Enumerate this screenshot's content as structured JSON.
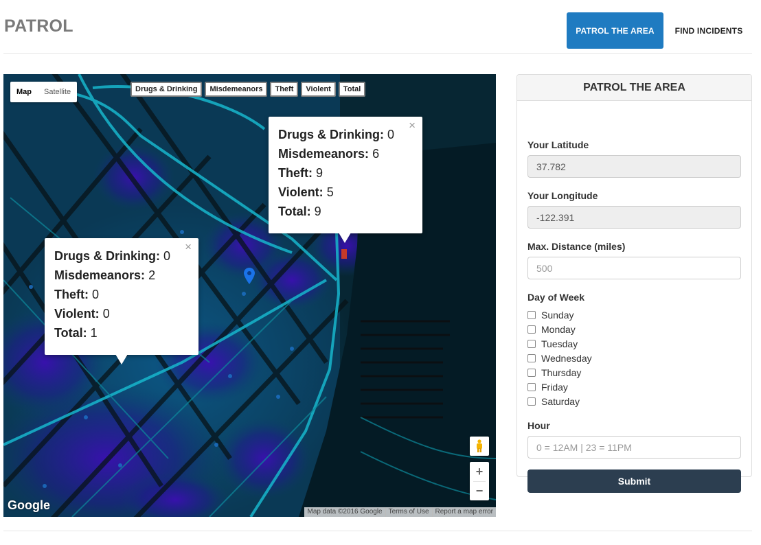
{
  "header": {
    "brand": "PATROL",
    "nav": [
      {
        "label": "PATROL THE AREA",
        "active": true
      },
      {
        "label": "FIND INCIDENTS",
        "active": false
      }
    ]
  },
  "map": {
    "map_type": {
      "map": "Map",
      "satellite": "Satellite",
      "selected": "Map"
    },
    "layers": [
      "Drugs & Drinking",
      "Misdemeanors",
      "Theft",
      "Violent",
      "Total"
    ],
    "popups": [
      {
        "rows": [
          {
            "label": "Drugs & Drinking:",
            "value": "0"
          },
          {
            "label": "Misdemeanors:",
            "value": "6"
          },
          {
            "label": "Theft:",
            "value": "9"
          },
          {
            "label": "Violent:",
            "value": "5"
          },
          {
            "label": "Total:",
            "value": "9"
          }
        ]
      },
      {
        "rows": [
          {
            "label": "Drugs & Drinking:",
            "value": "0"
          },
          {
            "label": "Misdemeanors:",
            "value": "2"
          },
          {
            "label": "Theft:",
            "value": "0"
          },
          {
            "label": "Violent:",
            "value": "0"
          },
          {
            "label": "Total:",
            "value": "1"
          }
        ]
      }
    ],
    "close_glyph": "×",
    "zoom_in": "+",
    "zoom_out": "−",
    "logo": "Google",
    "attribution": [
      "Map data ©2016 Google",
      "Terms of Use",
      "Report a map error"
    ],
    "icons": [
      "pegman-icon",
      "location-pin-icon",
      "close-icon"
    ],
    "colors": {
      "base": "#06222e",
      "heat": "#2a0d8a",
      "roads": "#16b4c8"
    }
  },
  "panel": {
    "title": "PATROL THE AREA",
    "latitude": {
      "label": "Your Latitude",
      "value": "37.782"
    },
    "longitude": {
      "label": "Your Longitude",
      "value": "-122.391"
    },
    "distance": {
      "label": "Max. Distance (miles)",
      "placeholder": "500"
    },
    "day_of_week": {
      "label": "Day of Week",
      "days": [
        "Sunday",
        "Monday",
        "Tuesday",
        "Wednesday",
        "Thursday",
        "Friday",
        "Saturday"
      ]
    },
    "hour": {
      "label": "Hour",
      "placeholder": "0 = 12AM | 23 = 11PM"
    },
    "submit": "Submit"
  },
  "colors": {
    "primary": "#1f7bc1",
    "submit": "#2c3e50"
  }
}
